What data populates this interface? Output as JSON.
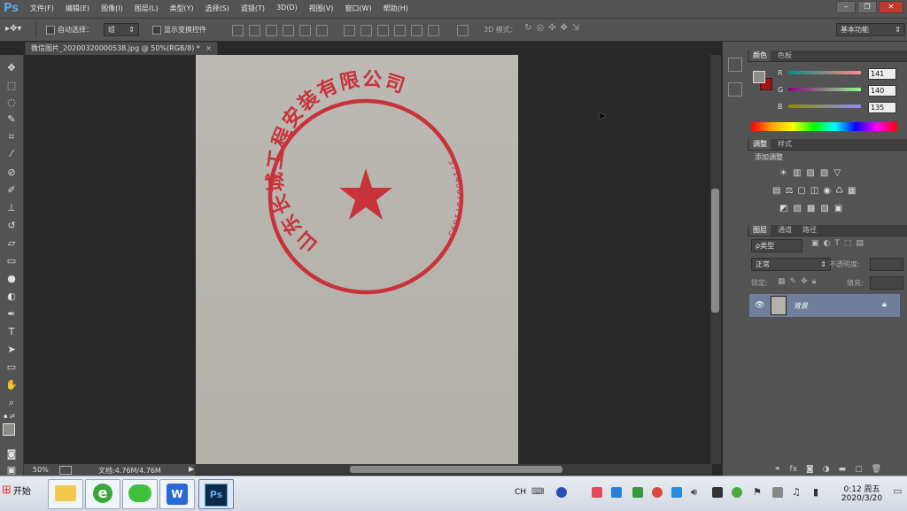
{
  "app": {
    "logo": "Ps"
  },
  "menu": [
    "文件(F)",
    "编辑(E)",
    "图像(I)",
    "图层(L)",
    "类型(Y)",
    "选择(S)",
    "滤镜(T)",
    "3D(D)",
    "视图(V)",
    "窗口(W)",
    "帮助(H)"
  ],
  "options": {
    "auto_select_label": "自动选择：",
    "auto_select_value": "组",
    "show_transform_label": "显示变换控件",
    "mode_3d_label": "3D 模式：",
    "workspace": "基本功能"
  },
  "document": {
    "tab_title": "微信图片_20200320000538.jpg @ 50%(RGB/8) *",
    "stamp_text": "山东长城工程安装有限公司",
    "stamp_number": "3714007871695"
  },
  "status": {
    "zoom": "50%",
    "doc_size": "文档:4.76M/4.76M"
  },
  "color_panel": {
    "tabs": [
      "颜色",
      "色板"
    ],
    "r_label": "R",
    "g_label": "G",
    "b_label": "B",
    "r": "141",
    "g": "140",
    "b": "135",
    "fg_color": "#8d8c87",
    "bg_color": "#a81018"
  },
  "adjust_panel": {
    "tabs": [
      "调整",
      "样式"
    ],
    "title": "添加调整"
  },
  "layers_panel": {
    "tabs": [
      "图层",
      "通道",
      "路径"
    ],
    "kind_filter": "ρ类型",
    "blend_mode": "正常",
    "opacity_label": "不透明度:",
    "lock_label": "锁定:",
    "fill_label": "填充:",
    "layer_name": "背景"
  },
  "taskbar": {
    "start_label": "开始",
    "lang": "CH",
    "time": "0:12 周五",
    "date": "2020/3/20"
  }
}
